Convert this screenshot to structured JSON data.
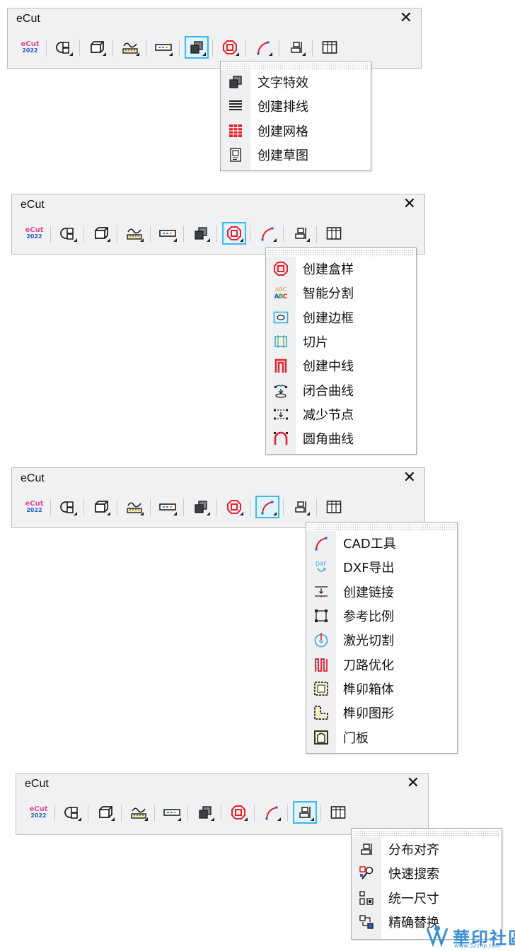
{
  "panels": [
    {
      "title": "eCut",
      "close": "✕",
      "toolbar": [
        {
          "icon": "ecut-logo-icon",
          "logo_top": "eCut",
          "logo_bottom": "2022"
        },
        {
          "icon": "shape-group-icon"
        },
        {
          "icon": "box-3d-icon"
        },
        {
          "icon": "measure-curve-icon"
        },
        {
          "icon": "ruler-strip-icon"
        },
        {
          "icon": "text-effect-icon"
        },
        {
          "icon": "box-sample-icon"
        },
        {
          "icon": "cad-curve-icon"
        },
        {
          "icon": "align-distribute-icon"
        },
        {
          "icon": "panel-table-icon"
        }
      ],
      "active_index": 5,
      "menu": [
        {
          "label": "文字特效",
          "icon": "text-effect-icon"
        },
        {
          "label": "创建排线",
          "icon": "lines-icon"
        },
        {
          "label": "创建网格",
          "icon": "grid-icon"
        },
        {
          "label": "创建草图",
          "icon": "sketch-icon"
        }
      ]
    },
    {
      "title": "eCut",
      "close": "✕",
      "active_index": 6,
      "menu": [
        {
          "label": "创建盒样",
          "icon": "box-sample-icon"
        },
        {
          "label": "智能分割",
          "icon": "abc-split-icon"
        },
        {
          "label": "创建边框",
          "icon": "border-frame-icon"
        },
        {
          "label": "切片",
          "icon": "slice-icon"
        },
        {
          "label": "创建中线",
          "icon": "center-line-icon"
        },
        {
          "label": "闭合曲线",
          "icon": "close-curve-icon"
        },
        {
          "label": "减少节点",
          "icon": "reduce-nodes-icon"
        },
        {
          "label": "圆角曲线",
          "icon": "round-corner-icon"
        }
      ]
    },
    {
      "title": "eCut",
      "close": "✕",
      "active_index": 7,
      "menu": [
        {
          "label": "CAD工具",
          "icon": "cad-curve-icon"
        },
        {
          "label": "DXF导出",
          "icon": "dxf-export-icon"
        },
        {
          "label": "创建链接",
          "icon": "create-link-icon"
        },
        {
          "label": "参考比例",
          "icon": "reference-scale-icon"
        },
        {
          "label": "激光切割",
          "icon": "laser-cut-icon"
        },
        {
          "label": "刀路优化",
          "icon": "toolpath-icon"
        },
        {
          "label": "榫卯箱体",
          "icon": "mortise-box-icon"
        },
        {
          "label": "榫卯图形",
          "icon": "mortise-shape-icon"
        },
        {
          "label": "门板",
          "icon": "door-panel-icon"
        }
      ]
    },
    {
      "title": "eCut",
      "close": "✕",
      "active_index": 8,
      "menu": [
        {
          "label": "分布对齐",
          "icon": "align-distribute-icon"
        },
        {
          "label": "快速搜索",
          "icon": "quick-search-icon"
        },
        {
          "label": "统一尺寸",
          "icon": "unify-size-icon"
        },
        {
          "label": "精确替换",
          "icon": "precise-replace-icon"
        }
      ]
    }
  ],
  "watermark": {
    "text": "華印社區",
    "url": "www.52cnp.com"
  },
  "colors": {
    "active_border": "#40b8e8",
    "grid_red": "#e8202a",
    "logo_pink": "#e54b9a",
    "logo_blue": "#2b59c3"
  }
}
